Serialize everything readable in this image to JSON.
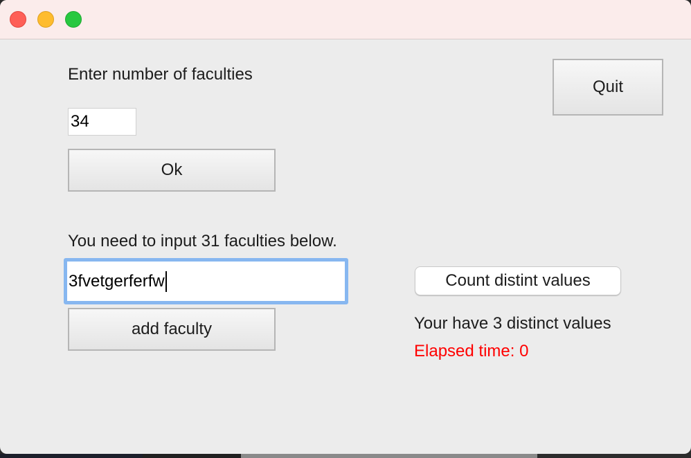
{
  "window": {
    "titlebar_color": "#fbeceb",
    "controls": [
      "close",
      "minimize",
      "zoom"
    ]
  },
  "form": {
    "prompt_label": "Enter number of faculties",
    "count_value": "34",
    "ok_label": "Ok",
    "quit_label": "Quit",
    "remaining_label": "You need to input 31 faculties below.",
    "faculty_value": "3fvetgerferfw",
    "add_label": "add faculty",
    "count_distinct_label": "Count distint values",
    "distinct_result": "Your have 3 distinct values",
    "elapsed_label": "Elapsed time: 0"
  },
  "colors": {
    "background": "#ececec",
    "focus_ring": "#87b7f0",
    "error_text": "#ff0000"
  }
}
